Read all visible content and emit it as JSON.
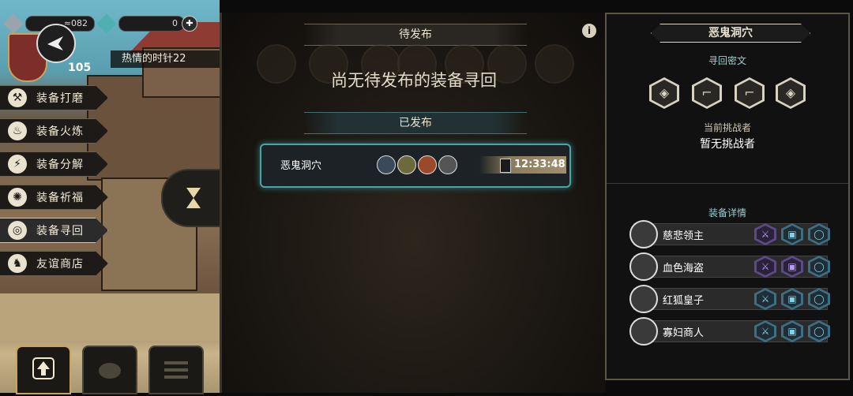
{
  "top": {
    "coins": "≈082",
    "gems": "0",
    "plus": "✚"
  },
  "player": {
    "level": "105",
    "warmth_label": "热情的时针22"
  },
  "menu": [
    {
      "label": "装备打磨",
      "icon": "hammer-icon",
      "glyph": "⚒"
    },
    {
      "label": "装备火炼",
      "icon": "flame-icon",
      "glyph": "♨"
    },
    {
      "label": "装备分解",
      "icon": "split-icon",
      "glyph": "⚡"
    },
    {
      "label": "装备祈福",
      "icon": "bless-icon",
      "glyph": "✺"
    },
    {
      "label": "装备寻回",
      "icon": "spiral-icon",
      "glyph": "◎"
    },
    {
      "label": "友谊商店",
      "icon": "fox-icon",
      "glyph": "♞"
    }
  ],
  "middle": {
    "pending_header": "待发布",
    "pending_empty": "尚无待发布的装备寻回",
    "published_header": "已发布",
    "card": {
      "name": "恶鬼洞穴",
      "timer": "12:33:48"
    },
    "info_glyph": "i"
  },
  "right": {
    "title": "恶鬼洞穴",
    "runes_label": "寻回密文",
    "challenger_label": "当前挑战者",
    "challenger_value": "暂无挑战者",
    "details_label": "装备详情",
    "bosses": [
      {
        "name": "慈悲领主",
        "sword": "purple",
        "armor": "blue",
        "ring": "blue"
      },
      {
        "name": "血色海盗",
        "sword": "purple",
        "armor": "purple",
        "ring": "blue"
      },
      {
        "name": "红狐皇子",
        "sword": "blue",
        "armor": "blue",
        "ring": "blue"
      },
      {
        "name": "寡妇商人",
        "sword": "blue",
        "armor": "blue",
        "ring": "blue"
      }
    ]
  },
  "colors": {
    "accent_teal": "#4aa3a4",
    "blue_tier": "#3f6e83",
    "purple_tier": "#5b4a86"
  }
}
